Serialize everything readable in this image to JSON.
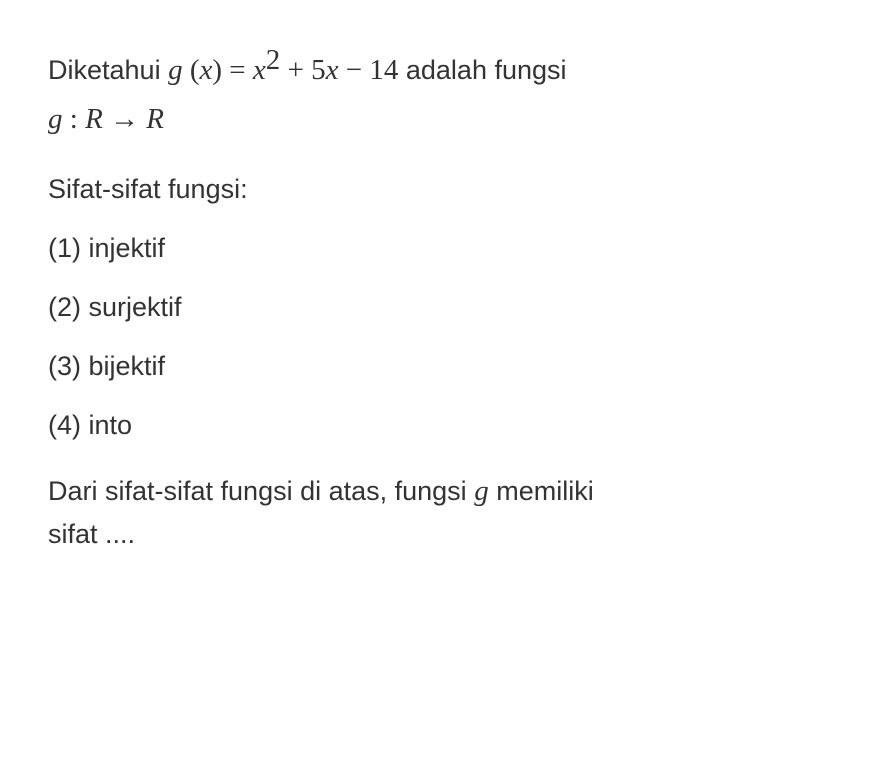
{
  "problem": {
    "intro_prefix": "Diketahui ",
    "func_def_g": "g",
    "func_def_open": " (",
    "func_def_x": "x",
    "func_def_close": ") = ",
    "func_def_x2": "x",
    "func_def_sq": "2",
    "func_def_plus": " + 5",
    "func_def_x3": "x",
    "func_def_minus": " − 14",
    "intro_suffix": " adalah fungsi",
    "domain_g": "g",
    "domain_colon": " : ",
    "domain_R1": "R",
    "domain_arrow": " → ",
    "domain_R2": "R"
  },
  "section_title": "Sifat-sifat fungsi:",
  "options": [
    "(1) injektif",
    "(2) surjektif",
    "(3) bijektif",
    "(4) into"
  ],
  "conclusion": {
    "prefix": "Dari sifat-sifat fungsi di atas, fungsi ",
    "g": "g",
    "suffix": " memiliki",
    "line2": "sifat ...."
  }
}
